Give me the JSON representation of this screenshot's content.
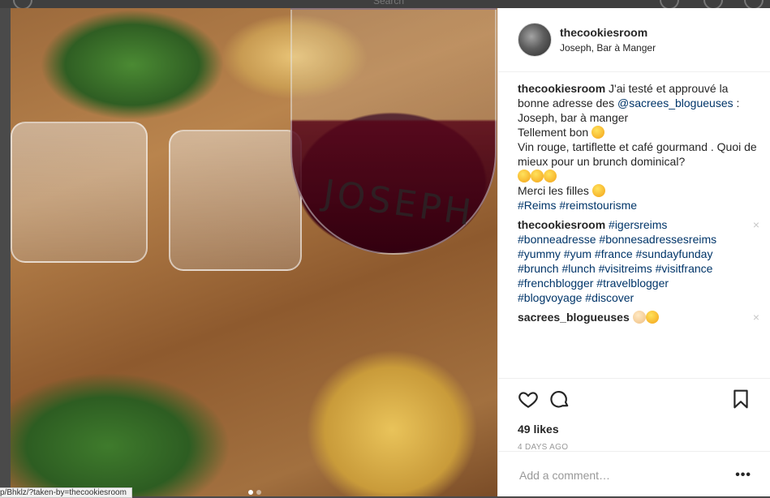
{
  "header_bg": {
    "search_placeholder": "Search"
  },
  "post": {
    "username": "thecookiesroom",
    "location": "Joseph, Bar à Manger",
    "image_label": "JOSEPH"
  },
  "comments": [
    {
      "user": "thecookiesroom",
      "lines": [
        {
          "text": "J'ai testé et approuvé la bonne adresse des "
        },
        {
          "tag": "@sacrees_blogueuses"
        },
        {
          "text": " : Joseph, bar à manger"
        },
        {
          "text2": "Tellement bon "
        },
        {
          "text3": "Vin rouge, tartiflette et café gourmand . Quoi de mieux pour un brunch dominical?"
        },
        {
          "text4": "Merci les filles "
        },
        {
          "tags": "#Reims #reimstourisme"
        }
      ]
    },
    {
      "user": "thecookiesroom",
      "tags_line1": "#igersreims",
      "tags_line2": "#bonneadresse #bonnesadressesreims",
      "tags_line3": "#yummy #yum #france #sundayfunday",
      "tags_line4": "#brunch #lunch #visitreims #visitfrance",
      "tags_line5": "#frenchblogger #travelblogger",
      "tags_line6": "#blogvoyage #discover"
    },
    {
      "user": "sacrees_blogueuses"
    }
  ],
  "actions": {
    "likes": "49 likes",
    "time_ago": "4 DAYS AGO"
  },
  "add_comment": {
    "placeholder": "Add a comment…",
    "more": "•••"
  },
  "status_url": "p/Bhklz/?taken-by=thecookiesroom",
  "remove_glyph": "×"
}
